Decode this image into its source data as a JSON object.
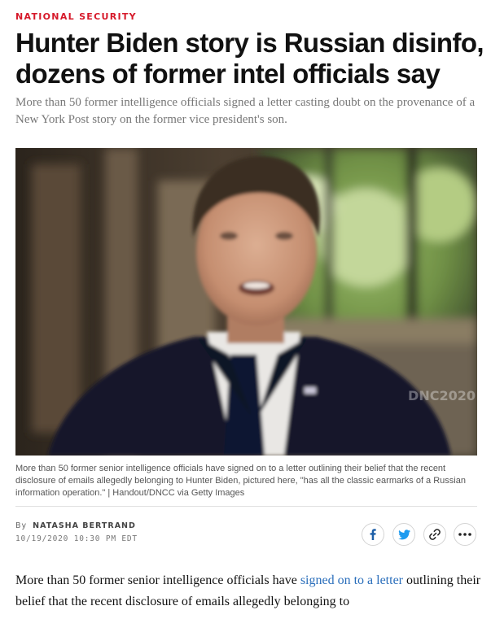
{
  "section": {
    "label": "NATIONAL SECURITY"
  },
  "article": {
    "headline": "Hunter Biden story is Russian disinfo, dozens of former intel officials say",
    "dek": "More than 50 former intelligence officials signed a letter casting doubt on the provenance of a New York Post story on the former vice president's son."
  },
  "photo": {
    "watermark": "DNC2020",
    "caption": "More than 50 former senior intelligence officials have signed on to a letter outlining their belief that the recent disclosure of emails allegedly belonging to Hunter Biden, pictured here, \"has all the classic earmarks of a Russian information operation.\" | Handout/DNCC via Getty Images"
  },
  "byline": {
    "prefix": "By",
    "author": "NATASHA BERTRAND",
    "timestamp": "10/19/2020 10:30 PM EDT"
  },
  "share_buttons": [
    {
      "name": "facebook",
      "icon": "facebook-icon"
    },
    {
      "name": "twitter",
      "icon": "twitter-icon"
    },
    {
      "name": "copy-link",
      "icon": "link-icon"
    },
    {
      "name": "more",
      "icon": "more-icon"
    }
  ],
  "body": {
    "text_before_link": "More than 50 former senior intelligence officials have ",
    "link_text": "signed on to a letter",
    "text_after_link": " outlining their belief that the recent disclosure of emails allegedly belonging to"
  },
  "colors": {
    "section_label": "#d6192a",
    "link": "#2a6ebb",
    "facebook": "#1d5fa8",
    "twitter": "#1d9bf0"
  }
}
